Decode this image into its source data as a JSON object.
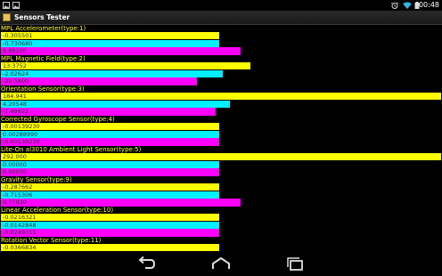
{
  "status_bar": {
    "time": "00:48"
  },
  "app": {
    "title": "Sensors Tester"
  },
  "colors": {
    "x_axis": "#ffff00",
    "y_axis": "#00f0ff",
    "z_axis": "#ff00ff",
    "sensor_title": "#ffff33"
  },
  "sensors": [
    {
      "name": "MPL Accelerometer(type:1)",
      "values": [
        {
          "text": "-0.305501",
          "level": 0.495
        },
        {
          "text": "-0.730680",
          "level": 0.495
        },
        {
          "text": "9.88100",
          "level": 0.545
        }
      ]
    },
    {
      "name": "MPL Magnetic Field(type:2)",
      "values": [
        {
          "text": "13.3752",
          "level": 0.566
        },
        {
          "text": "-2.02624",
          "level": 0.505
        },
        {
          "text": "-20.5800",
          "level": 0.445
        }
      ]
    },
    {
      "name": "Orientation Sensor(type:3)",
      "values": [
        {
          "text": "184.941",
          "level": 1.0
        },
        {
          "text": "4.20548",
          "level": 0.52
        },
        {
          "text": "-1.49622",
          "level": 0.488
        }
      ]
    },
    {
      "name": "Corrected Gyroscope Sensor(type:4)",
      "values": [
        {
          "text": "-0.00139230",
          "level": 0.496
        },
        {
          "text": "0.00288990",
          "level": 0.496
        },
        {
          "text": "-0.00139230",
          "level": 0.496
        }
      ]
    },
    {
      "name": "Lite-On al3010 Ambient Light Sensor(type:5)",
      "values": [
        {
          "text": "292.000",
          "level": 1.0
        },
        {
          "text": "0.00000",
          "level": 0.496
        },
        {
          "text": "0.00000",
          "level": 0.496
        }
      ]
    },
    {
      "name": "Gravity Sensor(type:9)",
      "values": [
        {
          "text": "-0.287662",
          "level": 0.495
        },
        {
          "text": "-0.715306",
          "level": 0.495
        },
        {
          "text": "9.77830",
          "level": 0.545
        }
      ]
    },
    {
      "name": "Linear Acceleration Sensor(type:10)",
      "values": [
        {
          "text": "-0.0216321",
          "level": 0.496
        },
        {
          "text": "-0.0142848",
          "level": 0.496
        },
        {
          "text": "-0.0249715",
          "level": 0.496
        }
      ]
    },
    {
      "name": "Rotation Vector Sensor(type:11)",
      "values": [
        {
          "text": "-0.0366834",
          "level": 0.496
        },
        {
          "text": "",
          "level": 0.496
        },
        {
          "text": "",
          "level": 0.496
        }
      ]
    }
  ],
  "nav": {
    "back_icon": "back-icon",
    "home_icon": "home-icon",
    "recents_icon": "recents-icon"
  }
}
